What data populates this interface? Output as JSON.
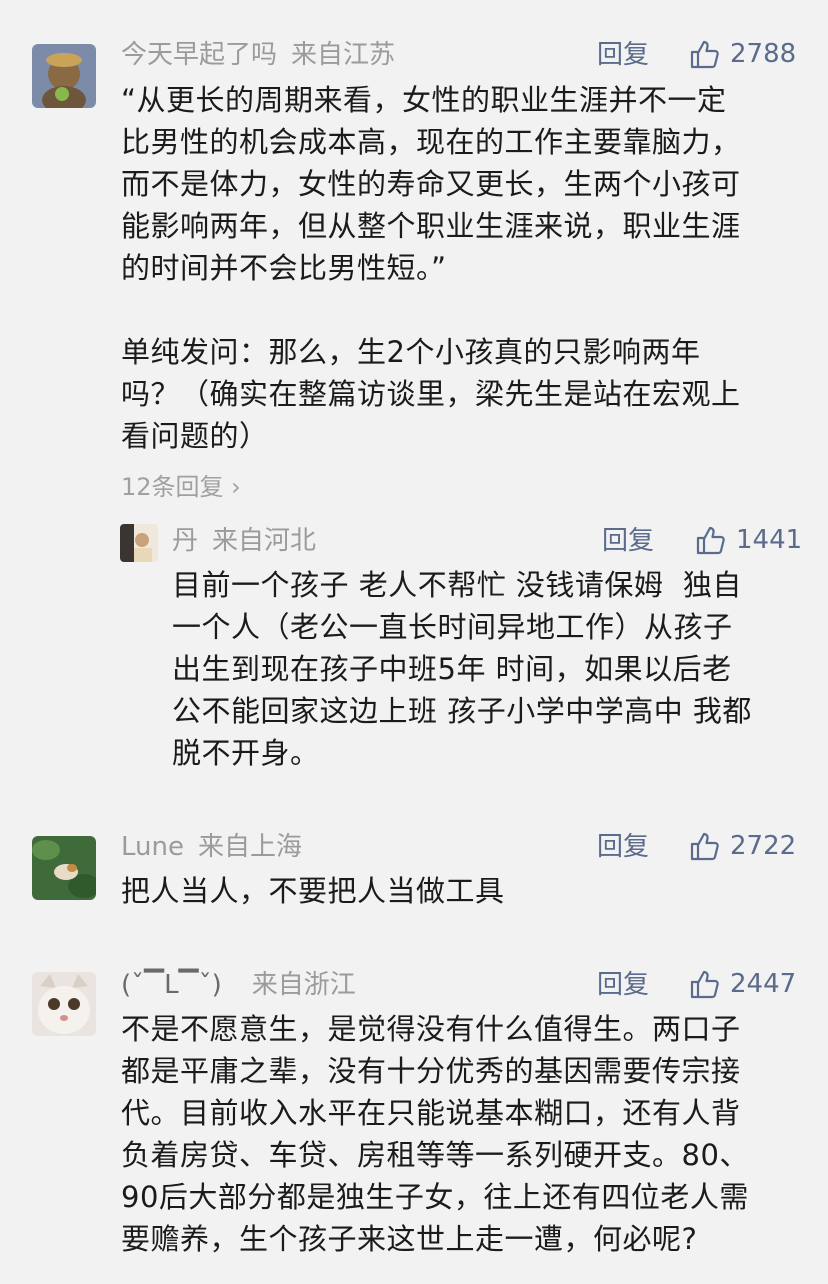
{
  "comments": [
    {
      "user": "今天早起了吗",
      "location": "来自江苏",
      "reply_label": "回复",
      "likes": "2788",
      "text": "“从更长的周期来看，女性的职业生涯并不一定\n比男性的机会成本高，现在的工作主要靠脑力，\n而不是体力，女性的寿命又更长，生两个小孩可\n能影响两年，但从整个职业生涯来说，职业生涯\n的时间并不会比男性短。”\n\n单纯发问：那么，生2个小孩真的只影响两年\n吗？（确实在整篇访谈里，梁先生是站在宏观上\n看问题的）",
      "more_replies": "12条回复 ›",
      "reply": {
        "user": "丹",
        "location": "来自河北",
        "reply_label": "回复",
        "likes": "1441",
        "text": "目前一个孩子 老人不帮忙 没钱请保姆  独自\n一个人（老公一直长时间异地工作）从孩子\n出生到现在孩子中班5年 时间，如果以后老\n公不能回家这边上班 孩子小学中学高中 我都\n脱不开身。"
      }
    },
    {
      "user": "Lune",
      "location": "来自上海",
      "reply_label": "回复",
      "likes": "2722",
      "text": "把人当人，不要把人当做工具"
    },
    {
      "user": "(ˇ▔L▔ˇ)",
      "location": "来自浙江",
      "reply_label": "回复",
      "likes": "2447",
      "text": "不是不愿意生，是觉得没有什么值得生。两口子\n都是平庸之辈，没有十分优秀的基因需要传宗接\n代。目前收入水平在只能说基本糊口，还有人背\n负着房贷、车贷、房租等等一系列硬开支。80、\n90后大部分都是独生子女，往上还有四位老人需\n要赡养，生个孩子来这世上走一遭，何必呢?"
    }
  ],
  "icons": {
    "like": "thumbs-up-icon"
  },
  "colors": {
    "action": "#5a6b8c",
    "meta": "#9b9b9b",
    "background": "#f2f2f2"
  }
}
